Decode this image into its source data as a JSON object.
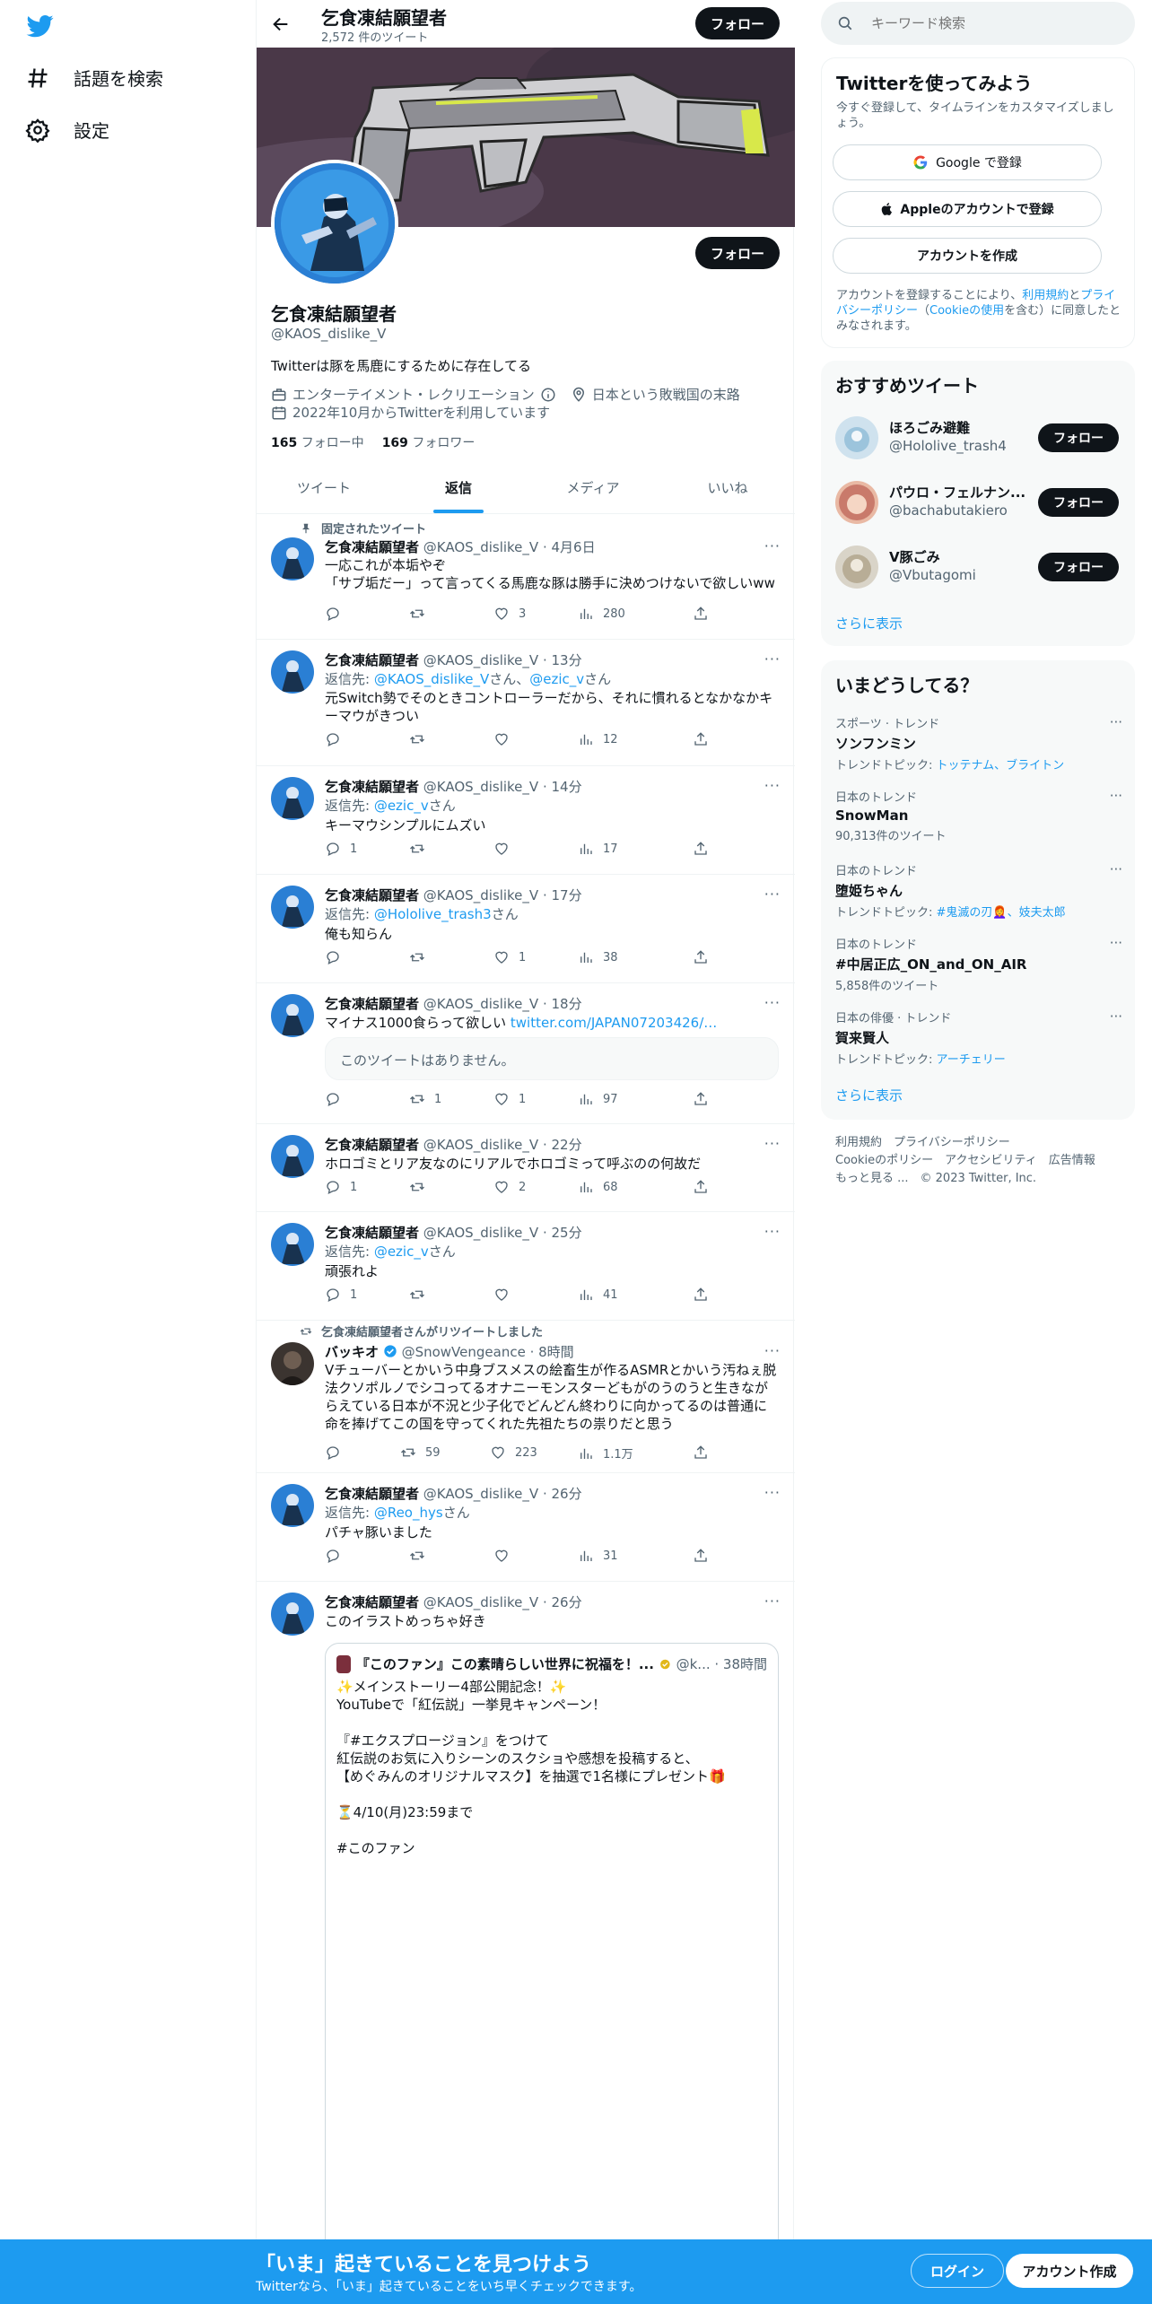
{
  "nav": {
    "items": [
      {
        "label": "話題を検索",
        "icon": "hashtag-icon"
      },
      {
        "label": "設定",
        "icon": "gear-icon"
      }
    ]
  },
  "header": {
    "name": "乞食凍結願望者",
    "tweet_count": "2,572 件のツイート",
    "follow": "フォロー"
  },
  "profile": {
    "name": "乞食凍結願望者",
    "handle": "@KAOS_dislike_V",
    "follow": "フォロー",
    "bio": "Twitterは豚を馬鹿にするために存在してる",
    "category": "エンターテイメント・レクリエーション",
    "location": "日本という敗戦国の末路",
    "joined": "2022年10月からTwitterを利用しています",
    "following_count": "165",
    "following_label": "フォロー中",
    "followers_count": "169",
    "followers_label": "フォロワー"
  },
  "tabs": [
    "ツイート",
    "返信",
    "メディア",
    "いいね"
  ],
  "pinned_label": "固定されたツイート",
  "tweets": [
    {
      "name": "乞食凍結願望者",
      "meta": "@KAOS_dislike_V · 4月6日",
      "line1": "一応これが本垢やぞ",
      "line2": "「サブ垢だー」って言ってくる馬鹿な豚は勝手に決めつけないで欲しいww",
      "rt": "",
      "like": "3",
      "views": "280"
    },
    {
      "name": "乞食凍結願望者",
      "meta": "@KAOS_dislike_V · 13分",
      "reply_prefix": "返信先: ",
      "reply_to1": "@KAOS_dislike_V",
      "reply_mid": "さん、",
      "reply_to2": "@ezic_v",
      "reply_suffix": "さん",
      "line1": "元Switch勢でそのときコントローラーだから、それに慣れるとなかなかキーマウがきつい",
      "views": "12"
    },
    {
      "name": "乞食凍結願望者",
      "meta": "@KAOS_dislike_V · 14分",
      "reply_prefix": "返信先: ",
      "reply_to1": "@ezic_v",
      "reply_suffix": "さん",
      "line1": "キーマウシンプルにムズい",
      "reply": "1",
      "views": "17"
    },
    {
      "name": "乞食凍結願望者",
      "meta": "@KAOS_dislike_V · 17分",
      "reply_prefix": "返信先: ",
      "reply_to1": "@Hololive_trash3",
      "reply_suffix": "さん",
      "line1": "俺も知らん",
      "like": "1",
      "views": "38"
    },
    {
      "name": "乞食凍結願望者",
      "meta": "@KAOS_dislike_V · 18分",
      "line1": "マイナス1000食らって欲しい ",
      "link": "twitter.com/JAPAN07203426/…",
      "quote": "このツイートはありません。",
      "rt": "1",
      "like": "1",
      "views": "97"
    },
    {
      "name": "乞食凍結願望者",
      "meta": "@KAOS_dislike_V · 22分",
      "line1": "ホロゴミとリア友なのにリアルでホロゴミって呼ぶのの何故だ",
      "reply": "1",
      "like": "2",
      "views": "68"
    },
    {
      "name": "乞食凍結願望者",
      "meta": "@KAOS_dislike_V · 25分",
      "reply_prefix": "返信先: ",
      "reply_to1": "@ezic_v",
      "reply_suffix": "さん",
      "line1": "頑張れよ",
      "reply": "1",
      "views": "41"
    },
    {
      "retweet_label": "乞食凍結願望者さんがリツイートしました",
      "name": "バッキオ",
      "meta": "@SnowVengeance · 8時間",
      "line1": "Vチューバーとかいう中身ブスメスの絵畜生が作るASMRとかいう汚ねぇ脱法クソポルノでシコってるオナニーモンスターどもがのうのうと生きながらえている日本が不況と少子化でどんどん終わりに向かってるのは普通に命を捧げてこの国を守ってくれた先祖たちの祟りだと思う",
      "rt": "59",
      "like": "223",
      "views": "1.1万"
    },
    {
      "name": "乞食凍結願望者",
      "meta": "@KAOS_dislike_V · 26分",
      "reply_prefix": "返信先: ",
      "reply_to1": "@Reo_hys",
      "reply_suffix": "さん",
      "line1": "パチャ豚いました",
      "views": "31"
    },
    {
      "name": "乞食凍結願望者",
      "meta": "@KAOS_dislike_V · 26分",
      "line1": "このイラストめっちゃ好き",
      "quote_name": "『このファン』この素晴らしい世界に祝福を！...",
      "quote_meta": "@k... · 38時間",
      "quote_lines": [
        "✨メインストーリー4部公開記念！✨",
        "YouTubeで「紅伝説」一挙見キャンペーン！",
        "",
        "『#エクスプロージョン』をつけて",
        "紅伝説のお気に入りシーンのスクショや感想を投稿すると、",
        "【めぐみんのオリジナルマスク】を抽選で1名様にプレゼント🎁",
        "",
        "⏳4/10(月)23:59まで",
        "",
        "#このファン"
      ]
    }
  ],
  "search": {
    "placeholder": "キーワード検索"
  },
  "signup": {
    "title": "Twitterを使ってみよう",
    "desc": "今すぐ登録して、タイムラインをカスタマイズしましょう。",
    "google": "Google で登録",
    "apple": "Appleのアカウントで登録",
    "create": "アカウントを作成",
    "legal_a": "アカウントを登録することにより、",
    "legal_b": "利用規約",
    "legal_c": "と",
    "legal_d": "プライバシーポリシー",
    "legal_e": "（",
    "legal_f": "Cookieの使用",
    "legal_g": "を含む）に同意したとみなされます。"
  },
  "recommend": {
    "title": "おすすめツイート",
    "users": [
      {
        "name": "ほろごみ避難",
        "handle": "@Hololive_trash4"
      },
      {
        "name": "パウロ・フェルナン...",
        "handle": "@bachabutakiero"
      },
      {
        "name": "V豚ごみ",
        "handle": "@Vbutagomi"
      }
    ],
    "follow": "フォロー",
    "more": "さらに表示"
  },
  "trends": {
    "title": "いまどうしてる？",
    "items": [
      {
        "ctx": "スポーツ · トレンド",
        "name": "ソンフンミン",
        "sub_prefix": "トレンドトピック: ",
        "sub_links": "トッテナム、ブライトン"
      },
      {
        "ctx": "日本のトレンド",
        "name": "SnowMan",
        "sub": "90,313件のツイート"
      },
      {
        "ctx": "日本のトレンド",
        "name": "堕姫ちゃん",
        "sub_prefix": "トレンドトピック: ",
        "sub_links": "#鬼滅の刃👩‍🦰、妓夫太郎"
      },
      {
        "ctx": "日本のトレンド",
        "name": "#中居正広_ON_and_ON_AIR",
        "sub": "5,858件のツイート"
      },
      {
        "ctx": "日本の俳優 · トレンド",
        "name": "賀来賢人",
        "sub_prefix": "トレンドトピック: ",
        "sub_links": "アーチェリー"
      }
    ],
    "more": "さらに表示"
  },
  "footer_links": {
    "line1": "利用規約　プライバシーポリシー",
    "line2": "Cookieのポリシー　アクセシビリティ　広告情報",
    "line3": "もっと見る ...　© 2023 Twitter, Inc."
  },
  "bottom": {
    "title": "「いま」起きていることを見つけよう",
    "sub": "Twitterなら、「いま」起きていることをいち早くチェックできます。",
    "login": "ログイン",
    "signup": "アカウント作成"
  },
  "colors": {
    "accent": "#1d9bf0",
    "text": "#0f1419",
    "muted": "#536471"
  }
}
